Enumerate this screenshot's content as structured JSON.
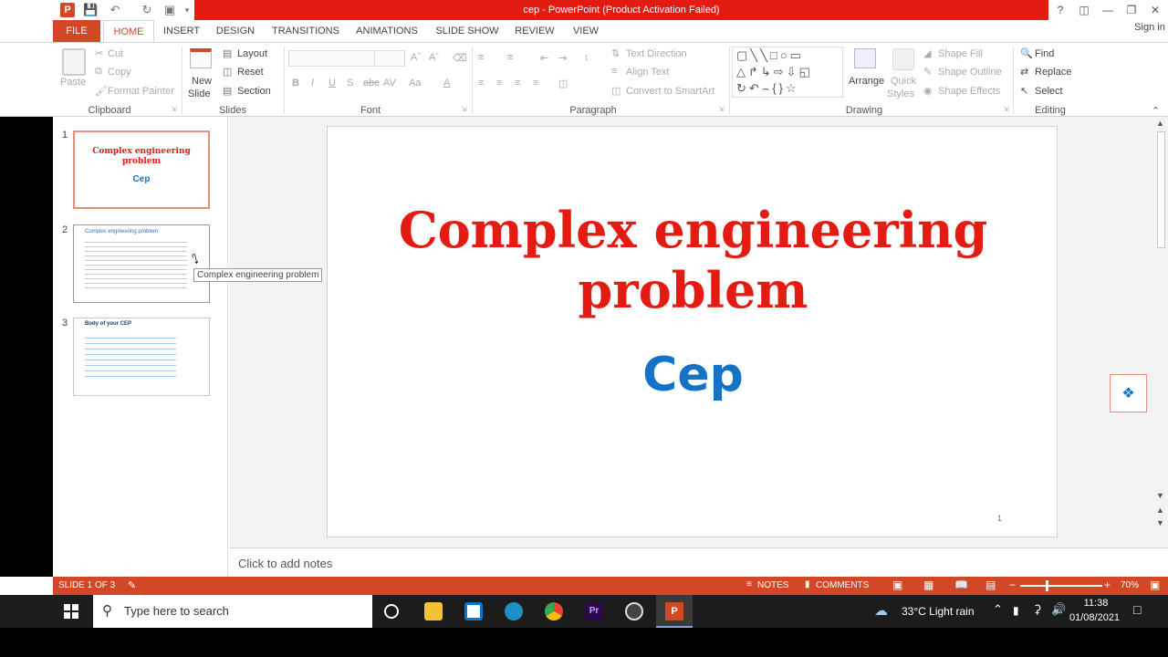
{
  "app": {
    "title": "cep  -  PowerPoint (Product Activation Failed)",
    "sign_in": "Sign in"
  },
  "tabs": [
    {
      "label": "FILE"
    },
    {
      "label": "HOME"
    },
    {
      "label": "INSERT"
    },
    {
      "label": "DESIGN"
    },
    {
      "label": "TRANSITIONS"
    },
    {
      "label": "ANIMATIONS"
    },
    {
      "label": "SLIDE SHOW"
    },
    {
      "label": "REVIEW"
    },
    {
      "label": "VIEW"
    }
  ],
  "ribbon": {
    "clipboard": {
      "label": "Clipboard",
      "paste": "Paste",
      "cut": "Cut",
      "copy": "Copy",
      "format_painter": "Format Painter"
    },
    "slides": {
      "label": "Slides",
      "new_slide": "New",
      "new_slide2": "Slide",
      "layout": "Layout",
      "reset": "Reset",
      "section": "Section"
    },
    "font": {
      "label": "Font"
    },
    "paragraph": {
      "label": "Paragraph",
      "text_direction": "Text Direction",
      "align_text": "Align Text",
      "convert_smartart": "Convert to SmartArt"
    },
    "drawing": {
      "label": "Drawing",
      "arrange": "Arrange",
      "quick_styles": "Quick",
      "quick_styles2": "Styles",
      "shape_fill": "Shape Fill",
      "shape_outline": "Shape Outline",
      "shape_effects": "Shape Effects"
    },
    "editing": {
      "label": "Editing",
      "find": "Find",
      "replace": "Replace",
      "select": "Select"
    }
  },
  "thumbnails": [
    {
      "num": "1",
      "title": "Complex engineering problem",
      "sub": "Cep"
    },
    {
      "num": "2",
      "title": "Complex engineering problem"
    },
    {
      "num": "3",
      "title": "Body of your CEP"
    }
  ],
  "tooltip": "Complex engineering problem",
  "slide": {
    "title_line1": "Complex engineering",
    "title_line2": "problem",
    "subtitle": "Cep",
    "number": "1"
  },
  "notes_placeholder": "Click to add notes",
  "status": {
    "slide_of": "SLIDE 1 OF 3",
    "notes": "NOTES",
    "comments": "COMMENTS",
    "zoom": "70%"
  },
  "taskbar": {
    "search_placeholder": "Type here to search",
    "weather": "33°C  Light rain",
    "time": "11:38",
    "date": "01/08/2021"
  },
  "colors": {
    "accent": "#d24726",
    "title_bar_red": "#e31b13",
    "slide_title": "#e31b13",
    "slide_subtitle": "#1473c5"
  }
}
